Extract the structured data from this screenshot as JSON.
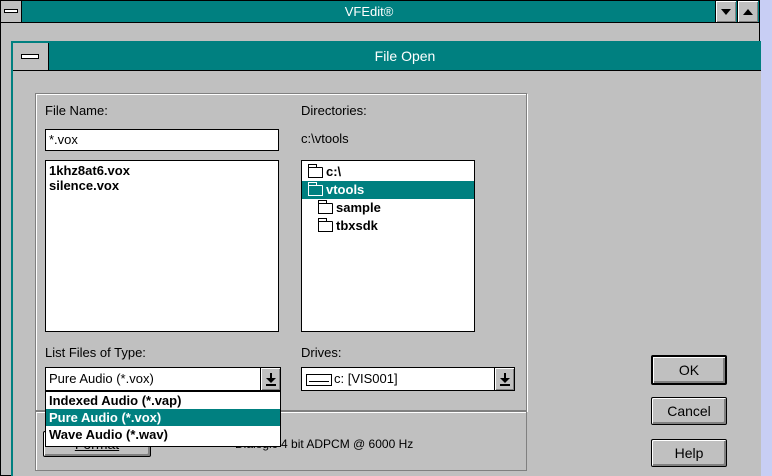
{
  "app": {
    "title": "VFEdit®"
  },
  "dialog": {
    "title": "File Open",
    "file_name": {
      "label": "File Name:",
      "value": "*.vox",
      "files": [
        "1khz8at6.vox",
        "silence.vox"
      ]
    },
    "directories": {
      "label": "Directories:",
      "current_path": "c:\\vtools",
      "items": [
        {
          "name": "c:\\",
          "state": "open"
        },
        {
          "name": "vtools",
          "state": "open-selected"
        },
        {
          "name": "sample",
          "state": "closed"
        },
        {
          "name": "tbxsdk",
          "state": "closed"
        }
      ]
    },
    "file_type": {
      "label": "List Files of Type:",
      "selected": "Pure Audio (*.vox)",
      "options": [
        "Indexed Audio (*.vap)",
        "Pure Audio (*.vox)",
        "Wave Audio (*.wav)"
      ]
    },
    "drives": {
      "label": "Drives:",
      "selected": "c: [VIS001]"
    },
    "format": {
      "button_label": "Format",
      "description": "Dialogic 4 bit ADPCM @ 6000 Hz"
    },
    "buttons": {
      "ok": "OK",
      "cancel": "Cancel",
      "help": "Help"
    }
  },
  "colors": {
    "titlebar": "#008080",
    "selection": "#008080",
    "face": "#c0c0c0",
    "desktop": "#c8cef4"
  }
}
